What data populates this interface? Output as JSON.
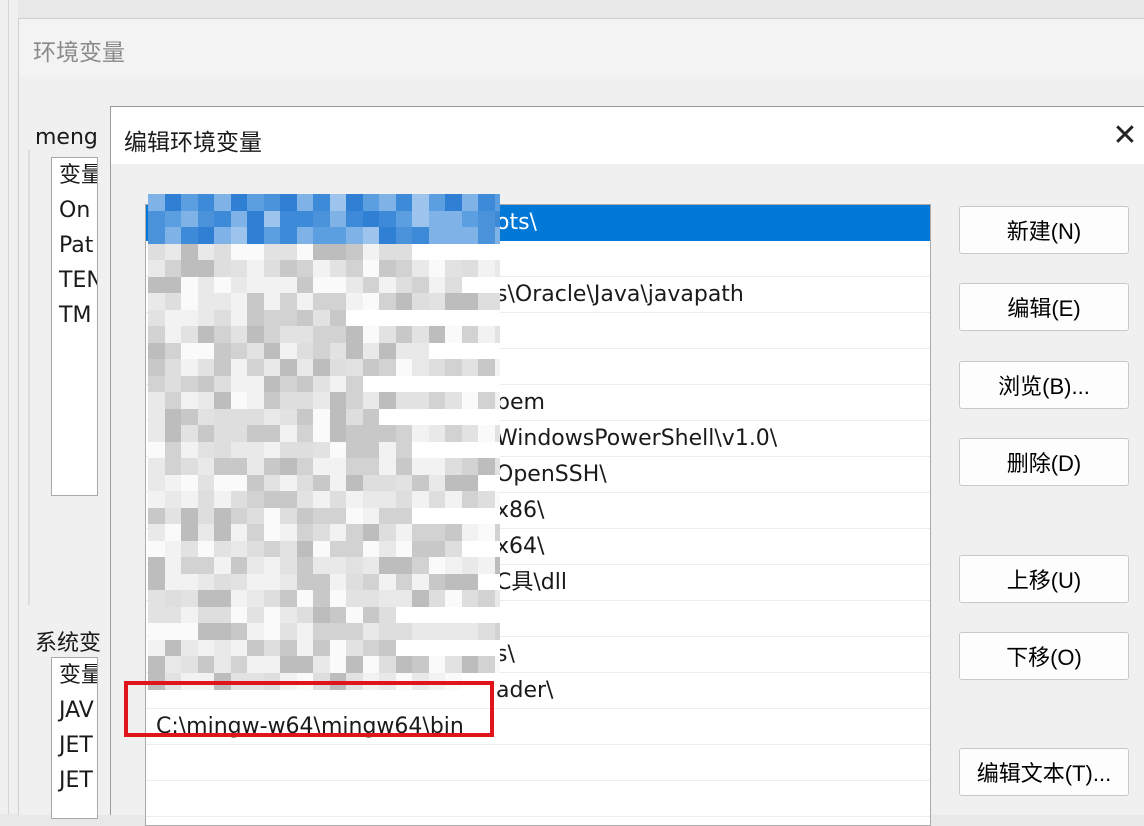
{
  "back_window": {
    "title": "环境变量",
    "user_group_label": "meng",
    "user_vars": [
      "变量",
      "On",
      "Pat",
      "TEN",
      "TM"
    ],
    "system_group_label": "系统变",
    "system_vars": [
      "变量",
      "JAV",
      "JET",
      "JET"
    ]
  },
  "dialog": {
    "title": "编辑环境变量",
    "close_glyph": "✕",
    "path_entries": [
      "ots\\",
      "",
      "s\\Oracle\\Java\\javapath",
      "",
      "",
      "bem",
      "WindowsPowerShell\\v1.0\\",
      "OpenSSH\\",
      "x86\\",
      "x64\\",
      "C具\\dll",
      "",
      "s\\",
      "ader\\",
      "C:\\mingw-w64\\mingw64\\bin",
      "",
      ""
    ],
    "selected_index": 0,
    "highlighted_index": 14,
    "buttons": {
      "new": "新建(N)",
      "edit": "编辑(E)",
      "browse": "浏览(B)...",
      "delete": "删除(D)",
      "move_up": "上移(U)",
      "move_down": "下移(O)",
      "edit_text": "编辑文本(T)..."
    },
    "colors": {
      "selection": "#0078d7",
      "highlight_box": "#e0141b"
    }
  }
}
